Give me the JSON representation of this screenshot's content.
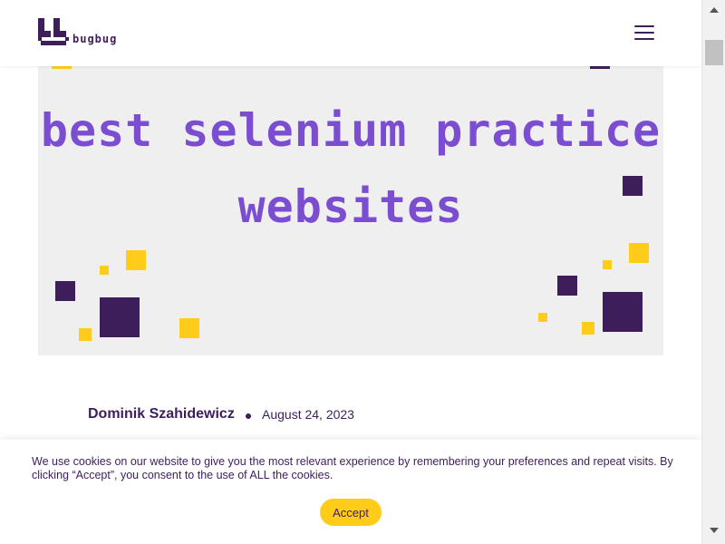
{
  "header": {
    "logo_text": "bugbug",
    "menu_icon": "hamburger-menu-icon"
  },
  "hero": {
    "title_line1": "best selenium practice",
    "title_line2": "websites",
    "colors": {
      "background": "#efefef",
      "title": "#7b4dd1",
      "purple": "#3d1e5a",
      "yellow": "#ffcc1a"
    }
  },
  "article": {
    "author": "Dominik Szahidewicz",
    "date": "August 24, 2023"
  },
  "cookie": {
    "text": "We use cookies on our website to give you the most relevant experience by remembering your preferences and repeat visits. By clicking “Accept”, you consent to the use of ALL the cookies.",
    "accept_label": "Accept"
  }
}
